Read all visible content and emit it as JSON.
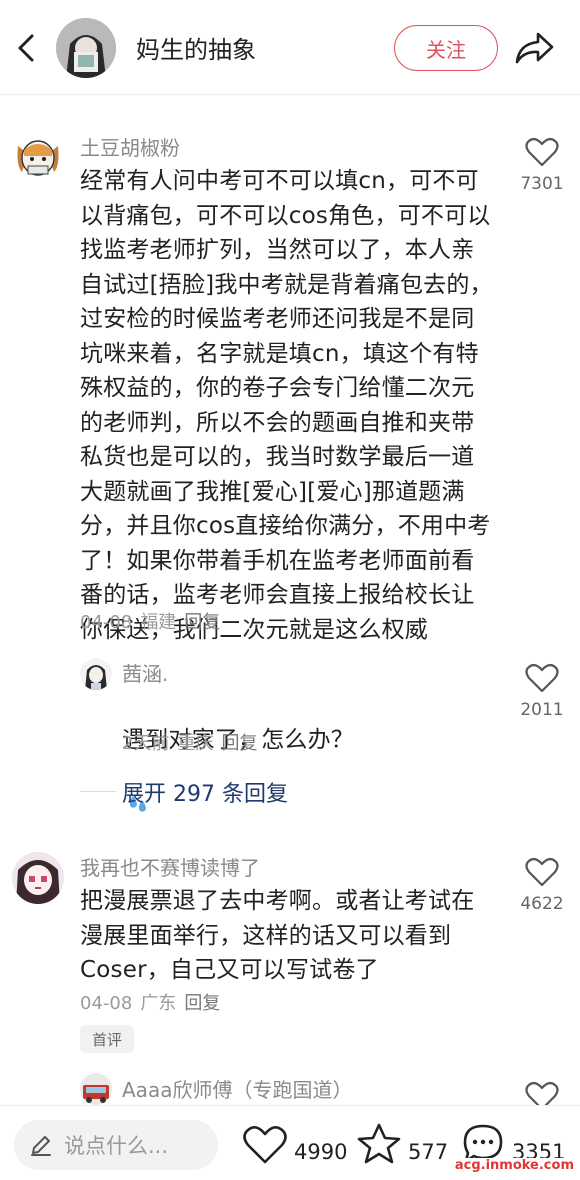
{
  "header": {
    "title": "妈生的抽象",
    "follow_label": "关注"
  },
  "comments": [
    {
      "username": "土豆胡椒粉",
      "text": "经常有人问中考可不可以填cn，可不可\n以背痛包，可不可以cos角色，可不可以\n找监考老师扩列，当然可以了，本人亲\n自试过[捂脸]我中考就是背着痛包去的，\n过安检的时候监考老师还问我是不是同\n坑咪来着，名字就是填cn，填这个有特\n殊权益的，你的卷子会专门给懂二次元\n的老师判，所以不会的题画自推和夹带\n私货也是可以的，我当时数学最后一道\n大题就画了我推[爱心][爱心]那道题满\n分，并且你cos直接给你满分，不用中考\n了！如果你带着手机在监考老师面前看\n番的话，监考老师会直接上报给校长让\n你保送，我们二次元就是这么权威",
      "date": "04-08",
      "location": "福建",
      "reply_label": "回复",
      "likes": "7301"
    },
    {
      "username": "茜涵.",
      "text": "遇到对家了，怎么办？",
      "emoji": "sweat-drops-emoji",
      "date": "2天前",
      "location": "重庆",
      "reply_label": "回复",
      "likes": "2011"
    },
    {
      "username": "我再也不赛博读博了",
      "text": "把漫展票退了去中考啊。或者让考试在\n漫展里面举行，这样的话又可以看到\nCoser，自己又可以写试卷了",
      "date": "04-08",
      "location": "广东",
      "reply_label": "回复",
      "likes": "4622",
      "badge": "首评"
    },
    {
      "username": "Aaaa欣师傅（专跑国道）"
    }
  ],
  "expand_replies": "展开 297 条回复",
  "bottom_bar": {
    "input_placeholder": "说点什么...",
    "likes": "4990",
    "stars": "577",
    "comments": "3351"
  },
  "watermark": "acg.inmoke.com",
  "colors": {
    "accent": "#e0525e",
    "link": "#1e3a6e"
  }
}
